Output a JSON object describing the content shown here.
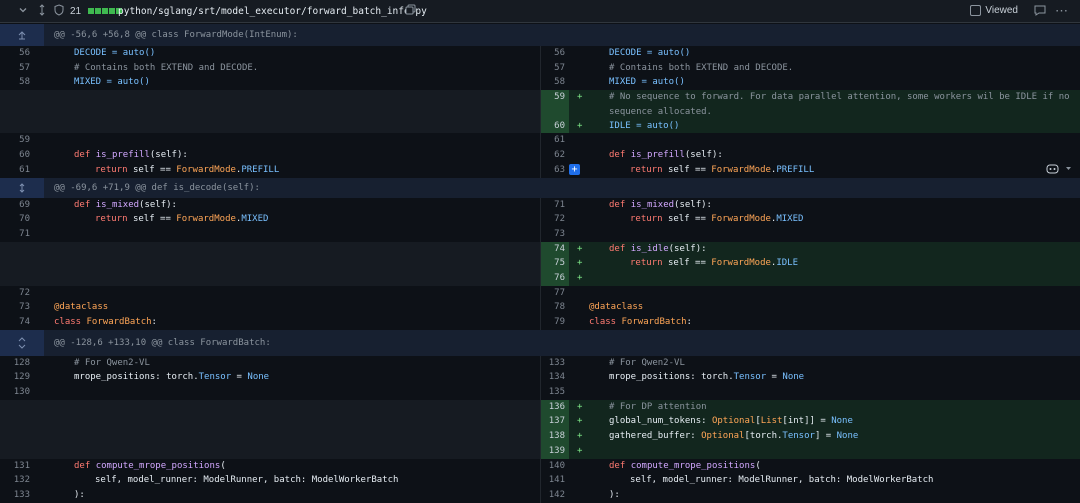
{
  "file": {
    "collapse_icon": "chevron-down-icon",
    "expand_icon": "unfold-icon",
    "shield_icon": "shield-icon",
    "changes": "21",
    "path": "python/sglang/srt/model_executor/forward_batch_info.py",
    "copy_icon": "copy-icon",
    "viewed_label": "Viewed",
    "comment_icon": "comment-icon",
    "more_icon": "kebab-icon"
  },
  "hunks": [
    "@@ -56,6 +56,8 @@ class ForwardMode(IntEnum):",
    "@@ -69,6 +71,9 @@ def is_decode(self):",
    "@@ -128,6 +133,10 @@ class ForwardBatch:"
  ],
  "lines": {
    "l56": "56",
    "l57": "57",
    "l58": "58",
    "l59": "59",
    "l60": "60",
    "l61": "61",
    "r56": "56",
    "r57": "57",
    "r58": "58",
    "r59": "59",
    "r60": "60",
    "r61": "61",
    "r62": "62",
    "r63": "63",
    "l69": "69",
    "l70": "70",
    "l71": "71",
    "l72": "72",
    "l73": "73",
    "l74": "74",
    "r71": "71",
    "r72": "72",
    "r73": "73",
    "r74": "74",
    "r75": "75",
    "r76": "76",
    "r77": "77",
    "r78": "78",
    "r79": "79",
    "l128": "128",
    "l129": "129",
    "l130": "130",
    "l131": "131",
    "l132": "132",
    "l133": "133",
    "r133": "133",
    "r134": "134",
    "r135": "135",
    "r136": "136",
    "r137": "137",
    "r138": "138",
    "r139": "139",
    "r140": "140",
    "r141": "141",
    "r142": "142"
  },
  "code": {
    "decode": "DECODE = auto()",
    "contains": "# Contains both EXTEND and DECODE.",
    "mixed": "MIXED = auto()",
    "no_seq": "# No sequence to forward. For data parallel attention, some workers wil be IDLE if no sequence allocated.",
    "idle": "IDLE = auto()",
    "def_is_prefill": "def is_prefill(self):",
    "ret_prefill": "return self == ForwardMode.PREFILL",
    "def_is_mixed": "def is_mixed(self):",
    "ret_mixed": "return self == ForwardMode.MIXED",
    "def_is_idle": "def is_idle(self):",
    "ret_idle": "return self == ForwardMode.IDLE",
    "dataclass": "@dataclass",
    "class_fb": "class ForwardBatch:",
    "qwen": "# For Qwen2-VL",
    "mrope": "mrope_positions: torch.Tensor = None",
    "dp": "# For DP attention",
    "gnt": "global_num_tokens: Optional[List[int]] = None",
    "gb": "gathered_buffer: Optional[torch.Tensor] = None",
    "compute": "def compute_mrope_positions(",
    "args": "self, model_runner: ModelRunner, batch: ModelWorkerBatch",
    "close": "):"
  },
  "signs": {
    "plus": "+"
  },
  "colors": {
    "add_bg": "#12261e",
    "add_num": "#1f4a2e",
    "hunk_bg": "#172030",
    "bg": "#0d1117"
  }
}
